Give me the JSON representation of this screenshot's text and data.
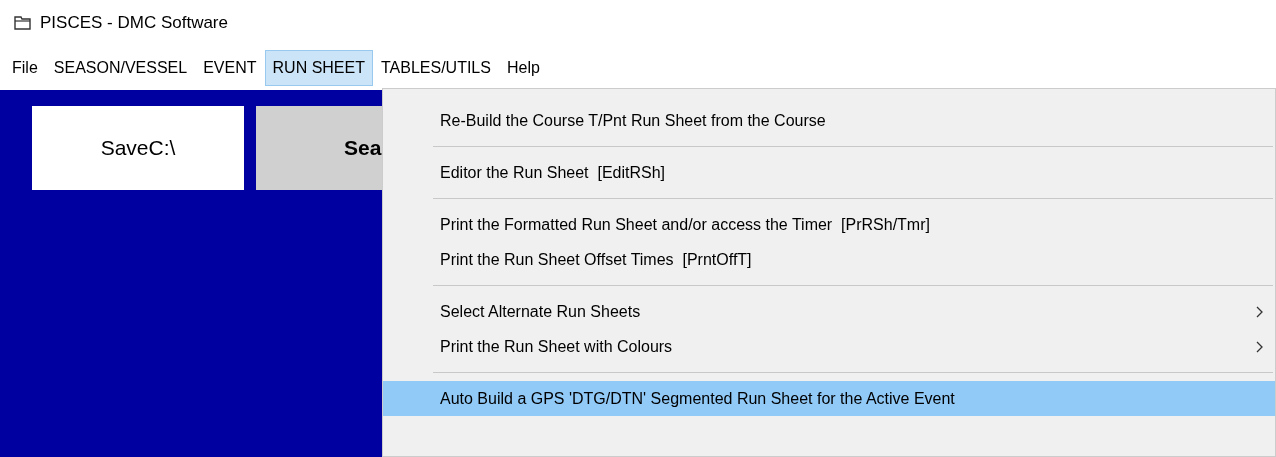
{
  "window": {
    "title": "PISCES - DMC Software"
  },
  "menu_bar": [
    {
      "label": "File",
      "selected": false
    },
    {
      "label": "SEASON/VESSEL",
      "selected": false
    },
    {
      "label": "EVENT",
      "selected": false
    },
    {
      "label": "RUN SHEET",
      "selected": true
    },
    {
      "label": "TABLES/UTILS",
      "selected": false
    },
    {
      "label": "Help",
      "selected": false
    }
  ],
  "buttons": [
    {
      "label": "SaveC:\\",
      "kind": "light"
    },
    {
      "label": "Sea",
      "kind": "bold"
    }
  ],
  "dropdown": {
    "groups": [
      [
        {
          "label": "Re-Build the Course T/Pnt Run Sheet from the Course",
          "submenu": false,
          "selected": false
        }
      ],
      [
        {
          "label": "Editor the Run Sheet  [EditRSh]",
          "submenu": false,
          "selected": false
        }
      ],
      [
        {
          "label": "Print the Formatted Run Sheet and/or access the Timer  [PrRSh/Tmr]",
          "submenu": false,
          "selected": false
        },
        {
          "label": "Print the Run Sheet Offset Times  [PrntOffT]",
          "submenu": false,
          "selected": false
        }
      ],
      [
        {
          "label": "Select Alternate Run Sheets",
          "submenu": true,
          "selected": false
        },
        {
          "label": "Print the Run Sheet with Colours",
          "submenu": true,
          "selected": false
        }
      ],
      [
        {
          "label": "Auto Build a GPS 'DTG/DTN' Segmented Run Sheet for the Active Event",
          "submenu": false,
          "selected": true
        }
      ]
    ]
  }
}
